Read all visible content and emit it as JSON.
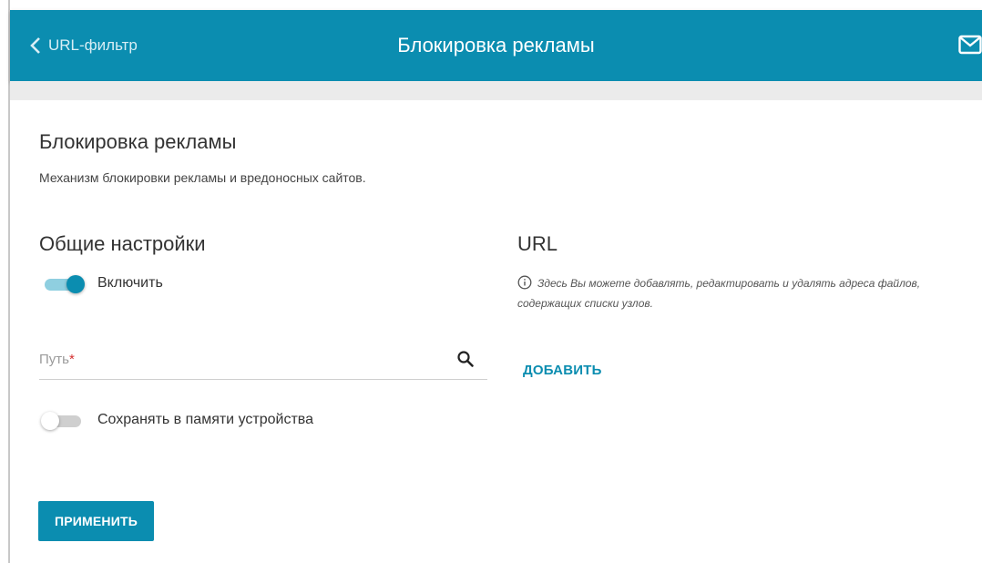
{
  "header": {
    "back_label": "URL-фильтр",
    "title": "Блокировка рекламы",
    "icons": {
      "back": "chevron-left-icon",
      "mail": "mail-icon"
    }
  },
  "page": {
    "title": "Блокировка рекламы",
    "description": "Механизм блокировки рекламы и вредоносных сайтов."
  },
  "general": {
    "title": "Общие настройки",
    "enable_label": "Включить",
    "enable_on": true,
    "path_placeholder": "Путь",
    "path_required_mark": "*",
    "save_label": "Сохранять в памяти устройства",
    "save_on": false
  },
  "url": {
    "title": "URL",
    "info": "Здесь Вы можете добавлять, редактировать и удалять адреса файлов, содержащих списки узлов.",
    "add_label": "ДОБАВИТЬ"
  },
  "actions": {
    "apply_label": "ПРИМЕНИТЬ"
  },
  "colors": {
    "accent": "#0b8db0",
    "band": "#ebebeb"
  }
}
